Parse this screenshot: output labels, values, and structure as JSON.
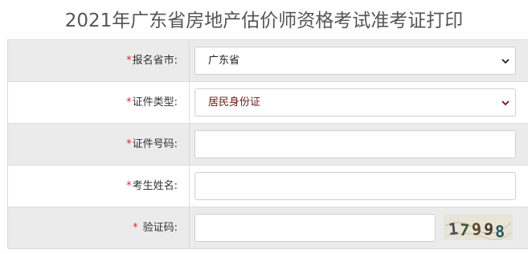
{
  "title": "2021年广东省房地产估价师资格考试准考证打印",
  "rows": [
    {
      "label": "报名省市:",
      "type": "select",
      "value": "广东省"
    },
    {
      "label": "证件类型:",
      "type": "select",
      "value": "居民身份证"
    },
    {
      "label": "证件号码:",
      "type": "input",
      "value": ""
    },
    {
      "label": "考生姓名:",
      "type": "input",
      "value": ""
    },
    {
      "label": "验证码:",
      "type": "captcha",
      "value": "",
      "captcha_text": "17998"
    }
  ],
  "required_mark": "*",
  "colors": {
    "required": "#e0242d",
    "row_shade": "#ebebeb",
    "border": "#dcdcdc"
  }
}
